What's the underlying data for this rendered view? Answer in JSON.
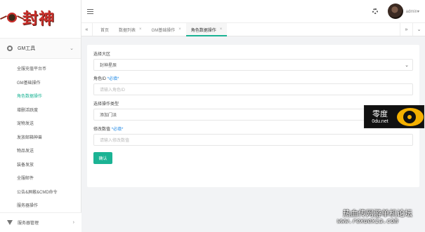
{
  "brand": {
    "logo_text": "封神"
  },
  "sidebar": {
    "group_label": "GM工具",
    "items": [
      {
        "label": "全服充值平台币",
        "active": false
      },
      {
        "label": "GM基础操作",
        "active": false
      },
      {
        "label": "角色数据操作",
        "active": true
      },
      {
        "label": "增删活跃度",
        "active": false
      },
      {
        "label": "宠物发送",
        "active": false
      },
      {
        "label": "发放邮箱神兽",
        "active": false
      },
      {
        "label": "物品发送",
        "active": false
      },
      {
        "label": "装备发放",
        "active": false
      },
      {
        "label": "全服邮件",
        "active": false
      },
      {
        "label": "公告&屏蔽&CMD命令",
        "active": false
      },
      {
        "label": "服务器操作",
        "active": false
      }
    ],
    "bottom_group_label": "服务器管理"
  },
  "header": {
    "username": "admin▾"
  },
  "tabs": [
    {
      "label": "首页",
      "closable": false,
      "active": false
    },
    {
      "label": "数据列表",
      "closable": true,
      "active": false
    },
    {
      "label": "GM基础操作",
      "closable": true,
      "active": false
    },
    {
      "label": "角色数据操作",
      "closable": true,
      "active": true
    }
  ],
  "form": {
    "region_label": "选择大区",
    "region_value": "封神星辰",
    "role_label": "角色ID",
    "role_hint": "*必填*",
    "role_placeholder": "请输入角色ID",
    "type_label": "选择操作类型",
    "type_value": "添加门派",
    "amount_label": "修改数值",
    "amount_hint": "*必填*",
    "amount_placeholder": "请输入修改数值",
    "submit_label": "确认"
  },
  "watermark": {
    "badge_big": "零度",
    "badge_small": "0du.net",
    "forum_cn": "热血传网游单机论坛",
    "forum_url": "www.rexuexia.com"
  },
  "colors": {
    "accent": "#1bb394",
    "hint": "#1e88e5",
    "brand_red": "#c9302c"
  }
}
